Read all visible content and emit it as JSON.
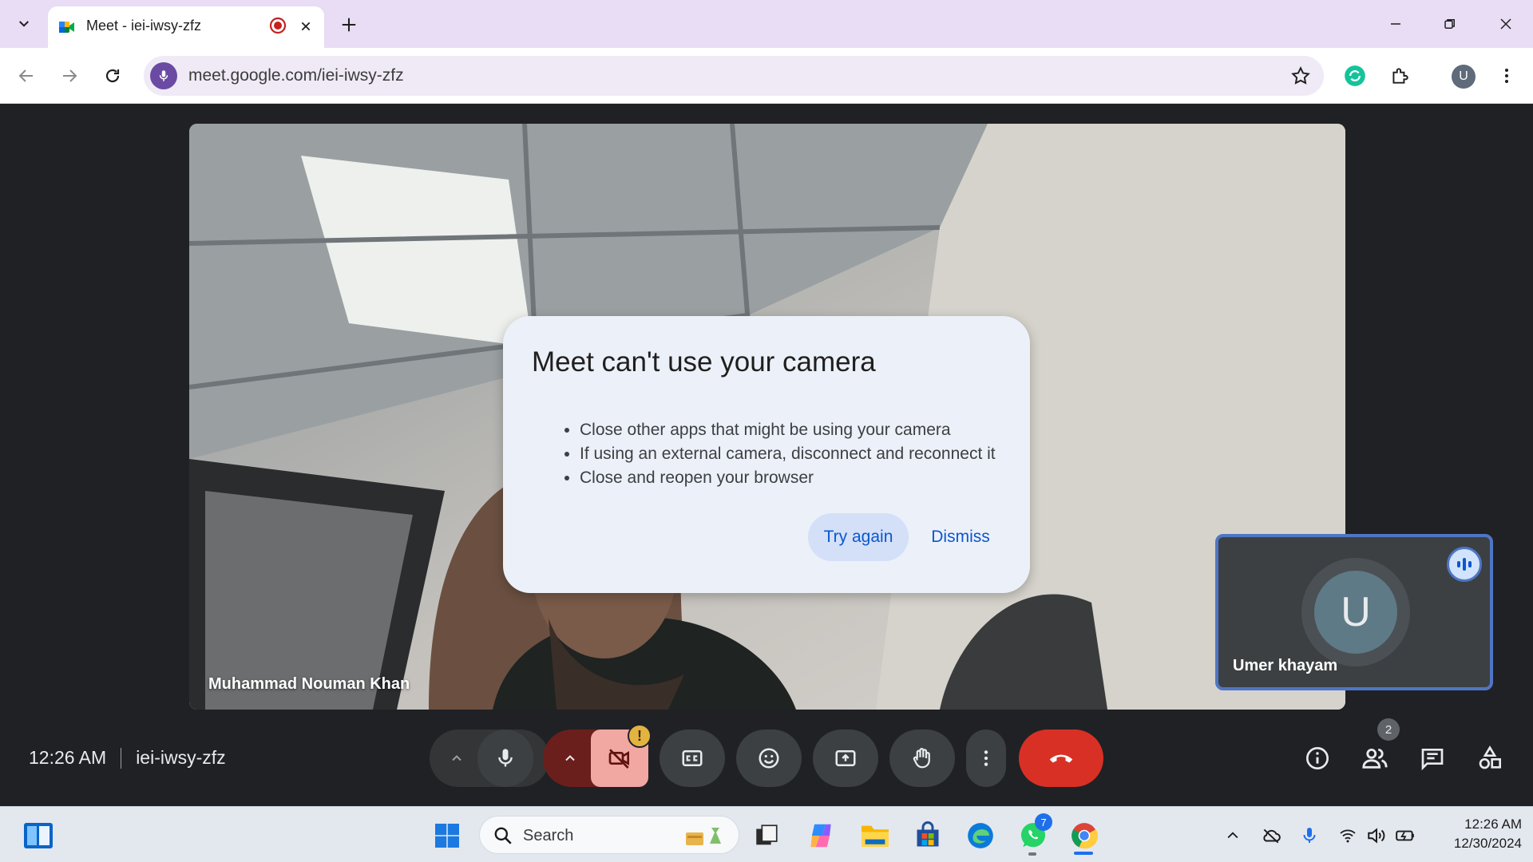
{
  "browser": {
    "tab_title": "Meet - iei-iwsy-zfz",
    "url": "meet.google.com/iei-iwsy-zfz",
    "profile_initial": "U"
  },
  "meet": {
    "speaker_name": "Muhammad Nouman Khan",
    "tile_name": "Umer khayam",
    "tile_initial": "U",
    "time": "12:26 AM",
    "meeting_code": "iei-iwsy-zfz",
    "people_count": "2"
  },
  "dialog": {
    "title": "Meet can't use your camera",
    "items": [
      "Close other apps that might be using your camera",
      "If using an external camera, disconnect and reconnect it",
      "Close and reopen your browser"
    ],
    "try_again": "Try again",
    "dismiss": "Dismiss"
  },
  "taskbar": {
    "search_placeholder": "Search",
    "whatsapp_badge": "7",
    "clock_time": "12:26 AM",
    "clock_date": "12/30/2024"
  },
  "colors": {
    "end_call": "#d93025",
    "camera_off_bg": "#f1a7a2",
    "accent_blue": "#0b57d0"
  }
}
